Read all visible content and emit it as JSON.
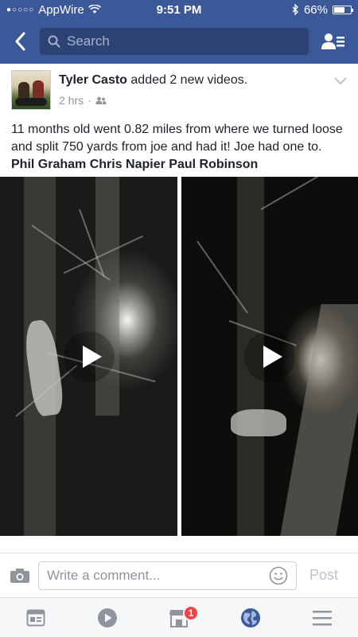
{
  "status_bar": {
    "carrier": "AppWire",
    "time": "9:51 PM",
    "battery": "66%",
    "battery_level": 0.66
  },
  "nav": {
    "search_placeholder": "Search"
  },
  "post": {
    "author": "Tyler Casto",
    "action": " added 2 new videos.",
    "time": "2 hrs",
    "text": "11 months old went 0.82 miles from where we turned loose and split 750 yards from joe and had it! Joe had one to. ",
    "tagged": "Phil Graham Chris Napier Paul Robinson"
  },
  "comment": {
    "placeholder": "Write a comment...",
    "post_label": "Post"
  },
  "tab_bar": {
    "notifications_count": "1",
    "items": [
      "news-feed",
      "video",
      "marketplace",
      "notifications",
      "more"
    ]
  },
  "colors": {
    "brand": "#3b5998",
    "badge": "#fa3e3e"
  }
}
